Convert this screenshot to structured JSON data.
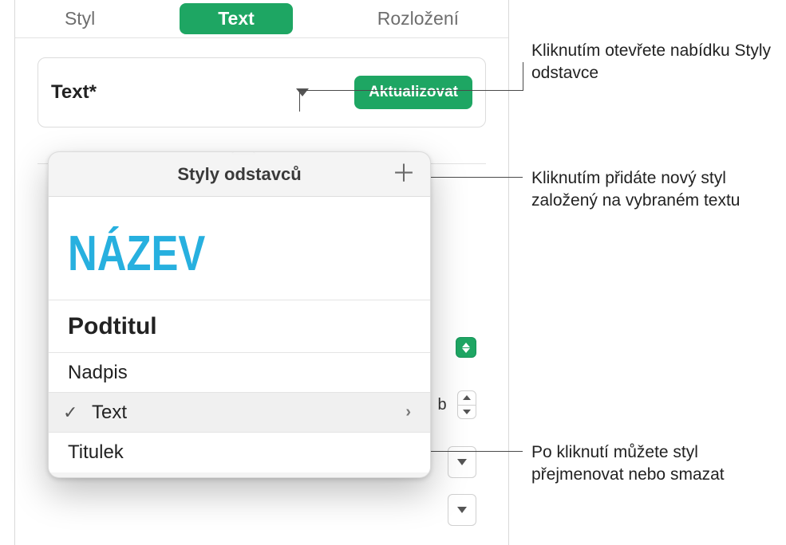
{
  "tabs": {
    "style": "Styl",
    "text": "Text",
    "layout": "Rozložení"
  },
  "stylebox": {
    "label": "Text*",
    "update": "Aktualizovat"
  },
  "popover": {
    "header": "Styly odstavců",
    "items": {
      "title_preview": "NÁZEV",
      "subtitle": "Podtitul",
      "heading": "Nadpis",
      "body": "Text",
      "caption": "Titulek"
    }
  },
  "bg": {
    "letter": "b"
  },
  "callouts": {
    "c1": "Kliknutím otevřete nabídku Styly odstavce",
    "c2": "Kliknutím přidáte nový styl založený na vybraném textu",
    "c3": "Po kliknutí můžete styl přejmenovat nebo smazat"
  }
}
